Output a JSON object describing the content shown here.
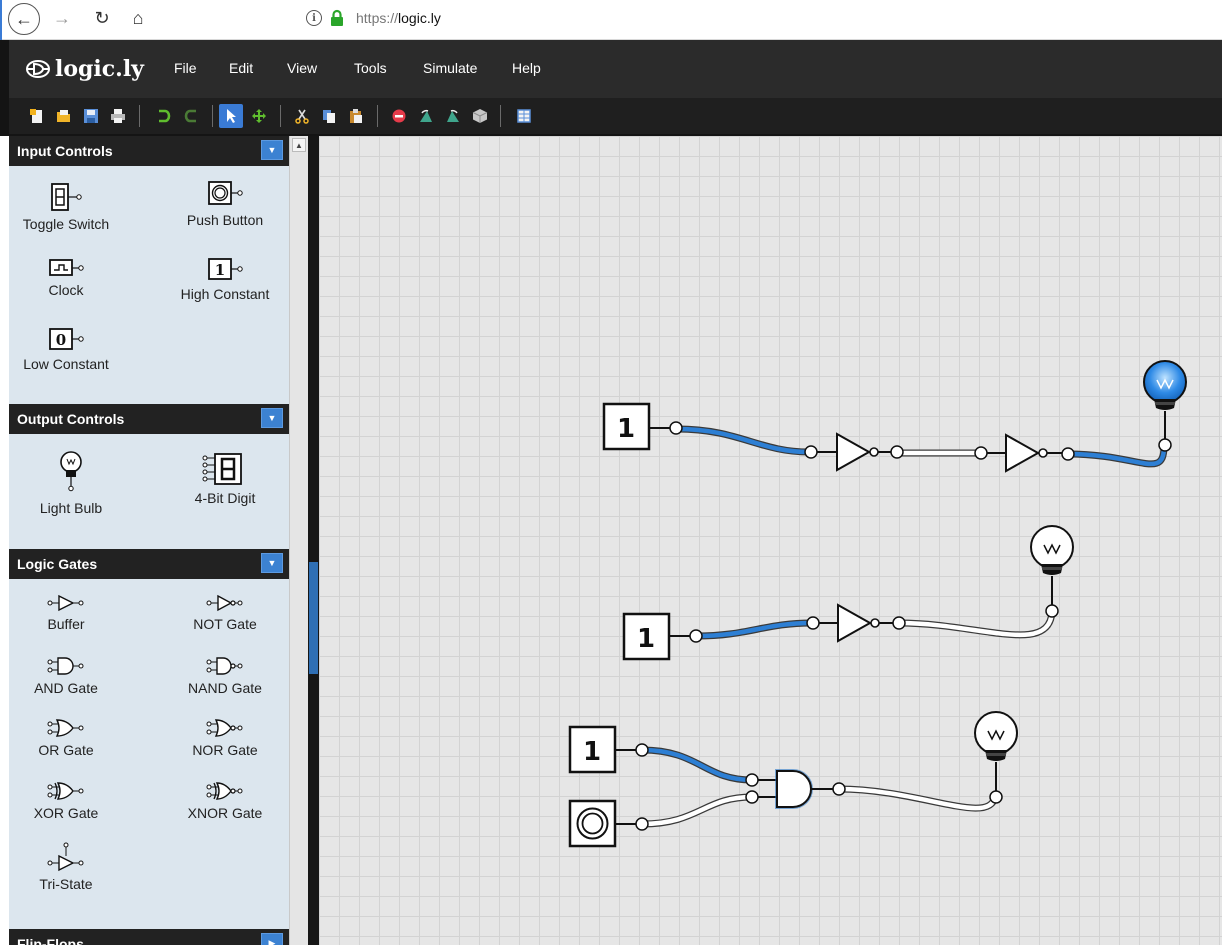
{
  "browser": {
    "url_prefix": "https://",
    "url_domain": "logic.ly"
  },
  "app": {
    "logo_text": "logic.ly",
    "menu": [
      "File",
      "Edit",
      "View",
      "Tools",
      "Simulate",
      "Help"
    ]
  },
  "toolbar": {
    "icons": [
      "new-file-icon",
      "open-folder-icon",
      "save-icon",
      "print-icon",
      "undo-icon",
      "redo-icon",
      "select-pointer-icon",
      "pan-move-icon",
      "cut-icon",
      "copy-icon",
      "paste-icon",
      "delete-icon",
      "rotate-left-icon",
      "rotate-right-icon",
      "package-icon",
      "truth-table-icon"
    ]
  },
  "sidebar": {
    "sections": {
      "input": {
        "title": "Input Controls",
        "items": [
          "Toggle Switch",
          "Push Button",
          "Clock",
          "High Constant",
          "Low Constant"
        ]
      },
      "output": {
        "title": "Output Controls",
        "items": [
          "Light Bulb",
          "4-Bit Digit"
        ]
      },
      "gates": {
        "title": "Logic Gates",
        "items": [
          "Buffer",
          "NOT Gate",
          "AND Gate",
          "NAND Gate",
          "OR Gate",
          "NOR Gate",
          "XOR Gate",
          "XNOR Gate",
          "Tri-State"
        ]
      },
      "flipflops": {
        "title": "Flip-Flops"
      }
    }
  },
  "canvas": {
    "constant_value": "1",
    "colors": {
      "active_wire": "#2d7fd4",
      "inactive_wire": "#ffffff",
      "wire_outline": "#3a3a3a",
      "bulb_on": "#2e8ae6"
    }
  }
}
